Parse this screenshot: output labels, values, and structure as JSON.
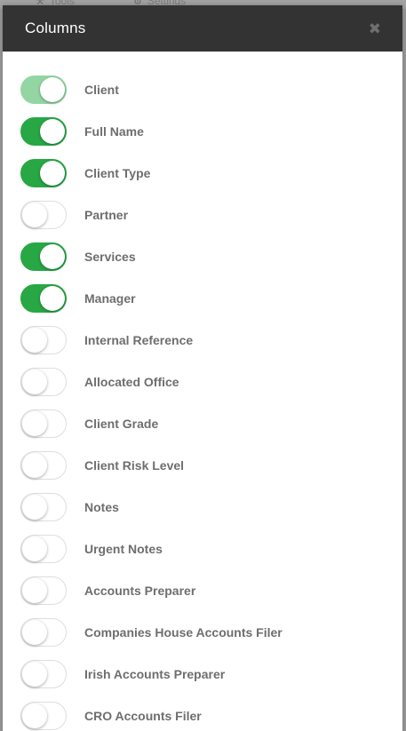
{
  "background": {
    "tabs": [
      {
        "label": "Tools",
        "icon": "wrench-icon"
      },
      {
        "label": "Settings",
        "icon": "gear-icon"
      }
    ]
  },
  "modal": {
    "title": "Columns",
    "close_icon": "close-icon",
    "columns": [
      {
        "label": "Client",
        "on": true,
        "disabled": true
      },
      {
        "label": "Full Name",
        "on": true,
        "disabled": false
      },
      {
        "label": "Client Type",
        "on": true,
        "disabled": false
      },
      {
        "label": "Partner",
        "on": false,
        "disabled": false
      },
      {
        "label": "Services",
        "on": true,
        "disabled": false
      },
      {
        "label": "Manager",
        "on": true,
        "disabled": false
      },
      {
        "label": "Internal Reference",
        "on": false,
        "disabled": false
      },
      {
        "label": "Allocated Office",
        "on": false,
        "disabled": false
      },
      {
        "label": "Client Grade",
        "on": false,
        "disabled": false
      },
      {
        "label": "Client Risk Level",
        "on": false,
        "disabled": false
      },
      {
        "label": "Notes",
        "on": false,
        "disabled": false
      },
      {
        "label": "Urgent Notes",
        "on": false,
        "disabled": false
      },
      {
        "label": "Accounts Preparer",
        "on": false,
        "disabled": false
      },
      {
        "label": "Companies House Accounts Filer",
        "on": false,
        "disabled": false
      },
      {
        "label": "Irish Accounts Preparer",
        "on": false,
        "disabled": false
      },
      {
        "label": "CRO Accounts Filer",
        "on": false,
        "disabled": false
      }
    ]
  },
  "colors": {
    "toggle_on": "#28a745",
    "toggle_on_disabled": "#93d6a3",
    "header_bg": "#333333"
  }
}
